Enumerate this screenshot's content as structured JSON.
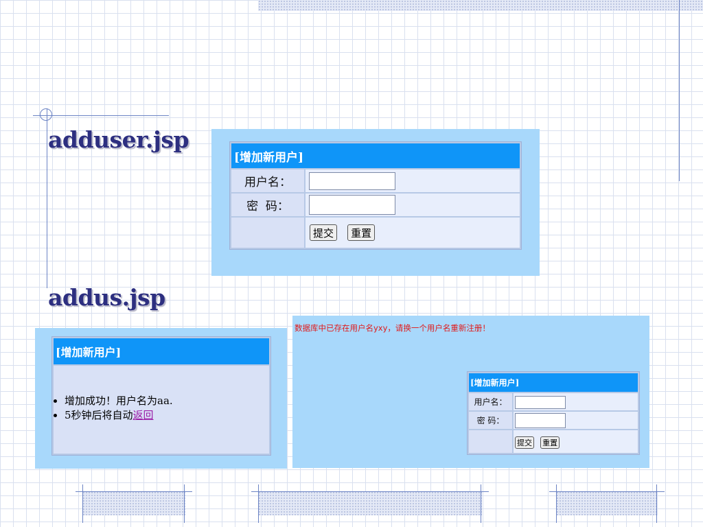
{
  "titles": {
    "first": "adduser.jsp",
    "second": "addus.jsp"
  },
  "form": {
    "header": "[增加新用户]",
    "username_label": "用户名：",
    "password_label": "密  码：",
    "submit_label": "提交",
    "reset_label": "重置",
    "username_value": "",
    "password_value": ""
  },
  "success": {
    "header": "[增加新用户]",
    "line1": "增加成功！用户名为aa.",
    "line2_prefix": "5秒钟后将自动",
    "line2_link": "返回"
  },
  "error": {
    "message": "数据库中已存在用户名yxy，请换一个用户名重新注册！",
    "header": "[增加新用户]",
    "username_label": "用户名：",
    "password_label": "密 码：",
    "submit_label": "提交",
    "reset_label": "重置"
  },
  "colors": {
    "title": "#2d2f80",
    "panel_bg": "#a8d8fb",
    "form_header": "#0f95f8",
    "error_text": "#e11919",
    "link": "#9a1aa6"
  }
}
